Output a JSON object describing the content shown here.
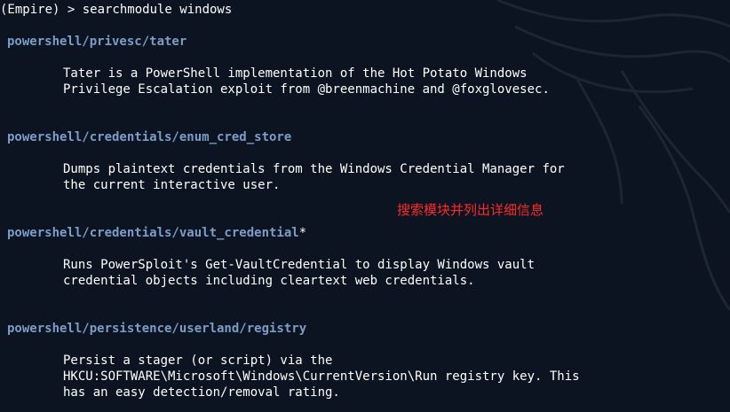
{
  "terminal": {
    "prompt": "(Empire) > ",
    "command": "searchmodule windows",
    "results": [
      {
        "name": "powershell/privesc/tater",
        "suffix": "",
        "description": [
          "Tater is a PowerShell implementation of the Hot Potato Windows",
          "Privilege Escalation exploit from @breenmachine and @foxglovesec."
        ]
      },
      {
        "name": "powershell/credentials/enum_cred_store",
        "suffix": "",
        "description": [
          "Dumps plaintext credentials from the Windows Credential Manager for",
          "the current interactive user."
        ]
      },
      {
        "name": "powershell/credentials/vault_credential",
        "suffix": "*",
        "description": [
          "Runs PowerSploit's Get-VaultCredential to display Windows vault",
          "credential objects including cleartext web credentials."
        ]
      },
      {
        "name": "powershell/persistence/userland/registry",
        "suffix": "",
        "description": [
          "Persist a stager (or script) via the",
          "HKCU:SOFTWARE\\Microsoft\\Windows\\CurrentVersion\\Run registry key. This",
          "has an easy detection/removal rating."
        ]
      }
    ]
  },
  "annotation": "搜索模块并列出详细信息",
  "colors": {
    "background": "#0b1420",
    "module_name": "#7d9cc8",
    "text": "#ffffff",
    "annotation": "#ff2a2a"
  }
}
